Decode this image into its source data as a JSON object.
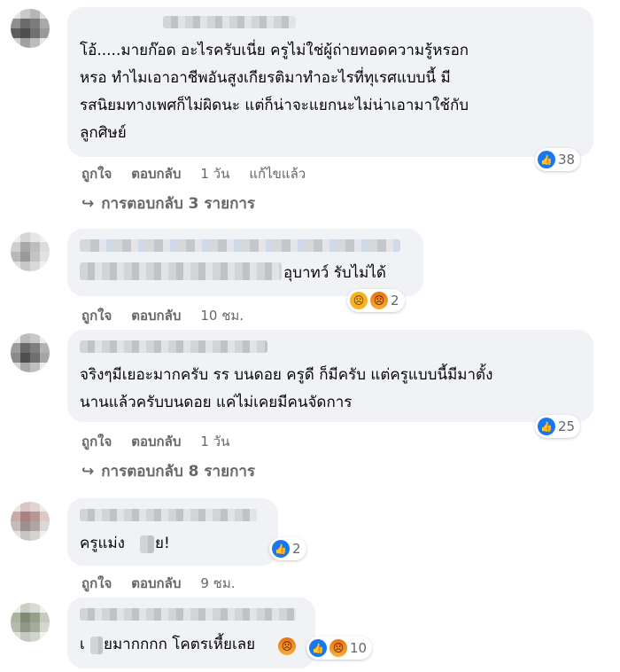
{
  "comments": [
    {
      "text": "โอ้.....มายก๊อด อะไรครับเนี่ย ครูไม่ใช่ผู้ถ่ายทอดความรู้หรอก\nหรอ ทำไมเอาอาชีพอันสูงเกียรติมาทำอะไรที่ทุเรศแบบนี้ มี\nรสนิยมทางเพศก็ไม่ผิดนะ แต่ก็น่าจะแยกนะไม่น่าเอามาใช้กับ\nลูกศิษย์",
      "reaction_count": "38",
      "reactions": [
        "like-icon"
      ],
      "like_label": "ถูกใจ",
      "reply_label": "ตอบกลับ",
      "time": "1 วัน",
      "edited": "แก้ไขแล้ว",
      "replies_label": "การตอบกลับ 3 รายการ"
    },
    {
      "text": "อุบาทว์ รับไม่ได้",
      "reaction_count": "2",
      "reactions": [
        "sad-icon",
        "angry-icon"
      ],
      "like_label": "ถูกใจ",
      "reply_label": "ตอบกลับ",
      "time": "10 ชม."
    },
    {
      "text": "จริงๆมีเยอะมากครับ รร บนดอย ครูดี ก็มีครับ แต่ครูแบบนี้มีมาตั้ง\nนานแล้วครับบนดอย แค่ไม่เคยมีคนจัดการ",
      "reaction_count": "25",
      "reactions": [
        "like-icon"
      ],
      "like_label": "ถูกใจ",
      "reply_label": "ตอบกลับ",
      "time": "1 วัน",
      "replies_label": "การตอบกลับ 8 รายการ"
    },
    {
      "text_a": "ครูแม่ง",
      "text_b": "ย!",
      "reaction_count": "2",
      "reactions": [
        "like-icon"
      ],
      "like_label": "ถูกใจ",
      "reply_label": "ตอบกลับ",
      "time": "9 ชม."
    },
    {
      "text_a": "เ",
      "text_b": "ยมากกกก โคตรเหี้ยเลย",
      "reaction_count": "10",
      "reactions": [
        "like-icon",
        "angry-icon"
      ]
    }
  ],
  "colors": {
    "bubble": "#f0f2f5",
    "secondary_text": "#65676b",
    "like": "#1877f2"
  }
}
